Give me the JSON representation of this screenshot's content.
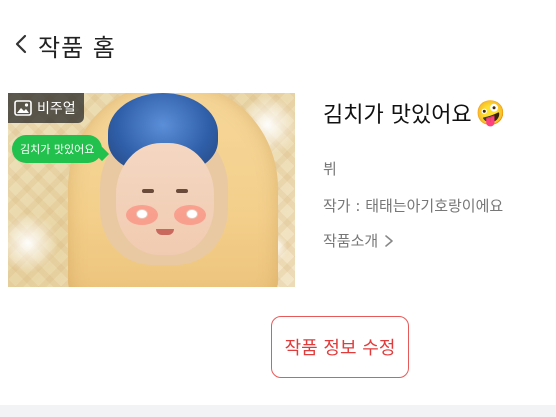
{
  "header": {
    "back_icon": "chevron-left-icon",
    "title": "작품 홈"
  },
  "cover": {
    "badge_label": "비주얼",
    "badge_icon": "image-icon",
    "chat_text": "김치가 맛있어요"
  },
  "work": {
    "title": "김치가 맛있어요",
    "title_emoji": "🤪",
    "artist": "뷔",
    "author": "작가 : 태태는아기호랑이에요",
    "intro_label": "작품소개",
    "intro_icon": "chevron-right-icon"
  },
  "actions": {
    "edit_label": "작품 정보 수정"
  },
  "colors": {
    "accent_red": "#e23b3b",
    "chat_green": "#22c04d"
  }
}
